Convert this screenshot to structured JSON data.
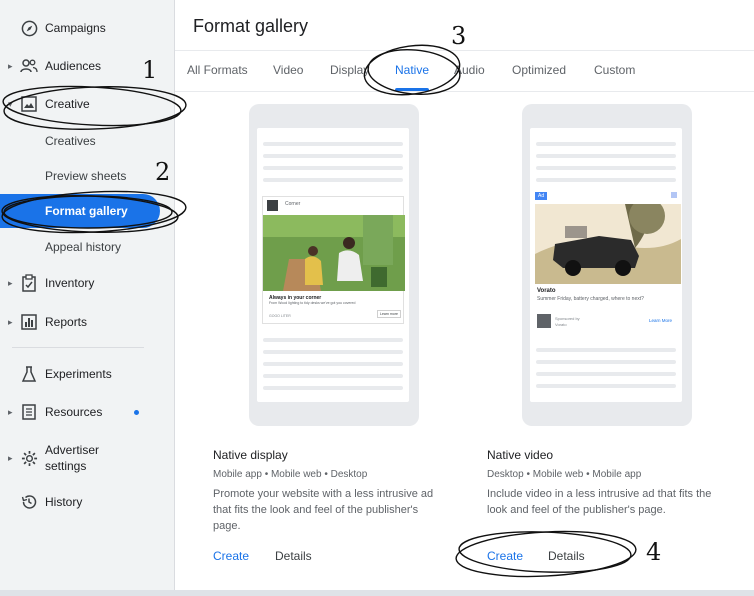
{
  "sidebar": {
    "items": [
      {
        "label": "Campaigns",
        "icon": "compass-icon"
      },
      {
        "label": "Audiences",
        "icon": "people-icon"
      },
      {
        "label": "Creative",
        "icon": "image-icon"
      },
      {
        "label": "Creatives"
      },
      {
        "label": "Preview sheets"
      },
      {
        "label": "Format gallery"
      },
      {
        "label": "Appeal history"
      },
      {
        "label": "Inventory",
        "icon": "clipboard-icon"
      },
      {
        "label": "Reports",
        "icon": "bar-chart-icon"
      },
      {
        "label": "Experiments",
        "icon": "flask-icon"
      },
      {
        "label": "Resources",
        "icon": "list-doc-icon"
      },
      {
        "label": "Advertiser settings",
        "line1": "Advertiser",
        "line2": "settings",
        "icon": "gear-icon"
      },
      {
        "label": "History",
        "icon": "history-icon"
      }
    ]
  },
  "main": {
    "title": "Format gallery",
    "tabs": [
      {
        "label": "All Formats"
      },
      {
        "label": "Video"
      },
      {
        "label": "Display"
      },
      {
        "label": "Native"
      },
      {
        "label": "Audio"
      },
      {
        "label": "Optimized"
      },
      {
        "label": "Custom"
      }
    ],
    "active_tab": "Native",
    "cards": [
      {
        "title": "Native display",
        "meta": "Mobile app • Mobile web • Desktop",
        "desc_line1": "Promote your website with a less intrusive ad",
        "desc_line2": "that fits the look and feel of the publisher's",
        "desc_line3": "page.",
        "create": "Create",
        "details": "Details",
        "preview": {
          "brand": "Corner",
          "headline": "Always in your corner",
          "body": "From Wood lighting to tidy desks we've got you covered",
          "footer": "GOGO LITER",
          "cta": "Learn more"
        }
      },
      {
        "title": "Native video",
        "meta": "Desktop • Mobile web • Mobile app",
        "desc_line1": "Include video in a less intrusive ad that fits the",
        "desc_line2": "look and feel of the publisher's page.",
        "create": "Create",
        "details": "Details",
        "preview": {
          "badge": "Ad",
          "headline": "Vorato",
          "body": "Summer Friday, battery charged, where to next?",
          "sponsor1": "Sponsored by",
          "sponsor2": "Vorato",
          "cta": "Learn More"
        }
      }
    ]
  },
  "annotations": [
    "1",
    "2",
    "3",
    "4"
  ],
  "colors": {
    "accent": "#1a73e8",
    "sidebar_bg": "#f1f3f4",
    "placeholder": "#e8eaed"
  }
}
